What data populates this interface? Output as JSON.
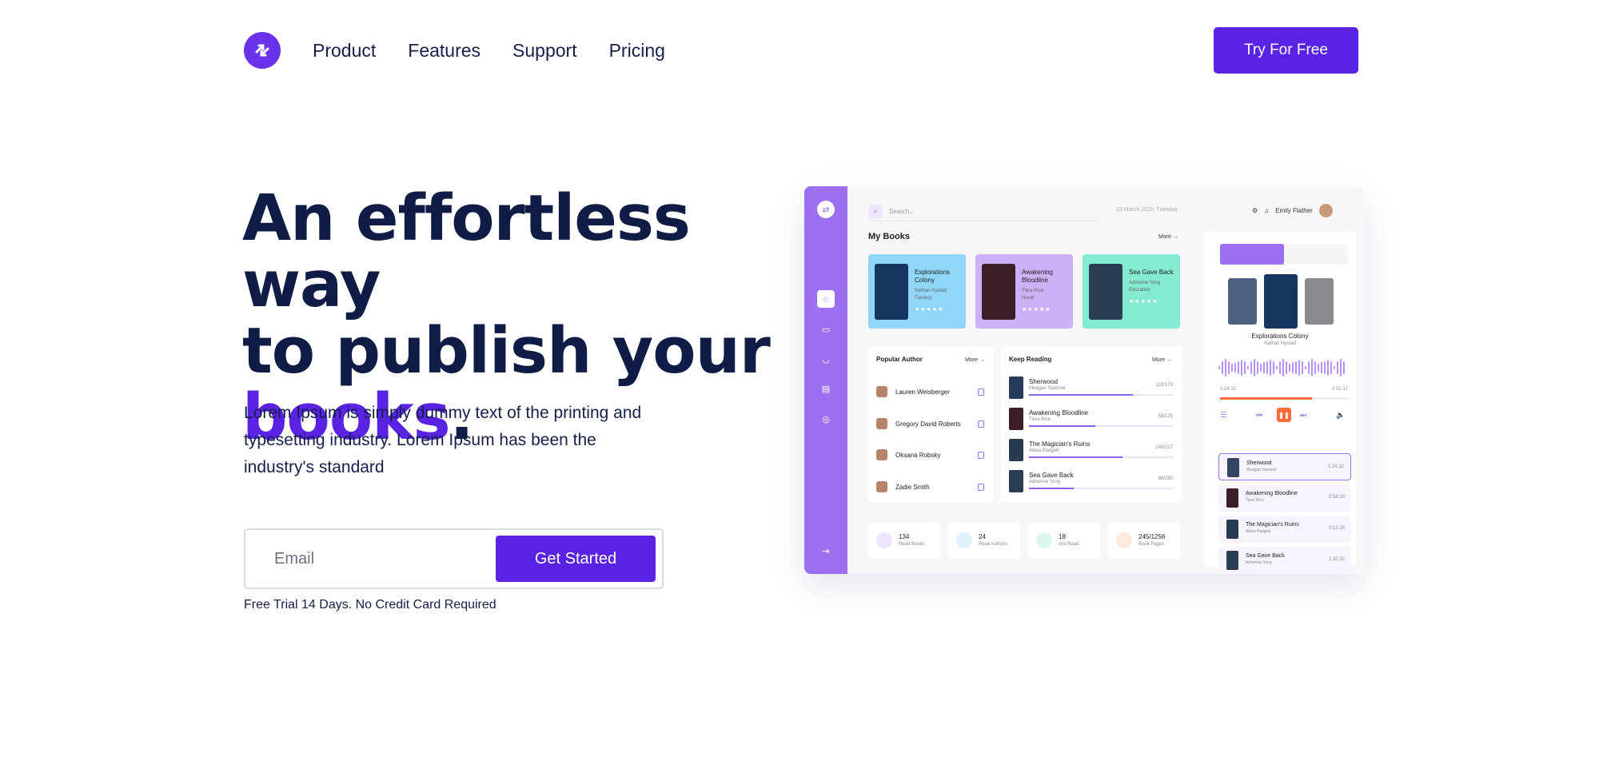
{
  "nav": {
    "items": [
      "Product",
      "Features",
      "Support",
      "Pricing"
    ],
    "cta": "Try For Free"
  },
  "hero": {
    "title_line1": "An effortless way",
    "title_line2": "to publish your",
    "title_accent": "books",
    "title_end": ".",
    "description": "Lorem Ipsum is simply dummy text of the printing and typesetting industry. Lorem Ipsum has been the industry's standard",
    "email_placeholder": "Email",
    "button": "Get Started",
    "trial_note": "Free Trial 14 Days. No Credit Card Required"
  },
  "colors": {
    "brand": "#5a22e2",
    "dashboard_sidebar": "#9d6ff1",
    "accent_orange": "#ff6b3d"
  },
  "dashboard": {
    "search_placeholder": "Search...",
    "date": "15 March 2020, Tuesday",
    "user_name": "Emily Flather",
    "my_books": {
      "title": "My Books",
      "more": "More",
      "books": [
        {
          "title": "Explorations Colony",
          "author": "Nathan Hystad",
          "genre": "Fantasy",
          "color": "#8fd6f7"
        },
        {
          "title": "Awakening Bloodline",
          "author": "Tiera Rice",
          "genre": "Novel",
          "color": "#cdb1f7"
        },
        {
          "title": "Sea Gave Back",
          "author": "Adrienne Yong",
          "genre": "Education",
          "color": "#84ebd0"
        }
      ]
    },
    "popular_author": {
      "title": "Popular Author",
      "more": "More",
      "authors": [
        "Lauren Weisberger",
        "Gregory David Roberts",
        "Oksana Robsky",
        "Zadie Smith"
      ]
    },
    "keep_reading": {
      "title": "Keep Reading",
      "more": "More",
      "items": [
        {
          "title": "Sherwood",
          "author": "Meagan Spooner",
          "pages": "123/170",
          "progress": 0.72
        },
        {
          "title": "Awakening Bloodline",
          "author": "Tiera Rice",
          "pages": "58/125",
          "progress": 0.46
        },
        {
          "title": "The Magician's Ruins",
          "author": "Alexa Padgett",
          "pages": "140/217",
          "progress": 0.65
        },
        {
          "title": "Sea Gave Back",
          "author": "Adrienne Yong",
          "pages": "86/280",
          "progress": 0.31
        }
      ]
    },
    "stats": [
      {
        "value": "134",
        "label": "Read Books",
        "color": "#efe6fd"
      },
      {
        "value": "24",
        "label": "Read Authors",
        "color": "#e0f1fb"
      },
      {
        "value": "18",
        "label": "Are Read",
        "color": "#dcf7ee"
      },
      {
        "value": "245/1256",
        "label": "Book Pages",
        "color": "#ffe7dc"
      }
    ],
    "player": {
      "now_playing_title": "Explorations Colony",
      "now_playing_author": "Nathan Hystad",
      "time_elapsed": "1:24:12",
      "time_total": "2:31:17",
      "progress": 0.72,
      "queue": [
        {
          "title": "Sherwood",
          "author": "Meagan Spooner",
          "duration": "1:24:12"
        },
        {
          "title": "Awakening Bloodline",
          "author": "Tiera Rice",
          "duration": "2:34:19"
        },
        {
          "title": "The Magician's Ruins",
          "author": "Alexa Padgett",
          "duration": "3:12:19"
        },
        {
          "title": "Sea Gave Back",
          "author": "Adrienne Yong",
          "duration": "1:32:32"
        }
      ]
    }
  }
}
